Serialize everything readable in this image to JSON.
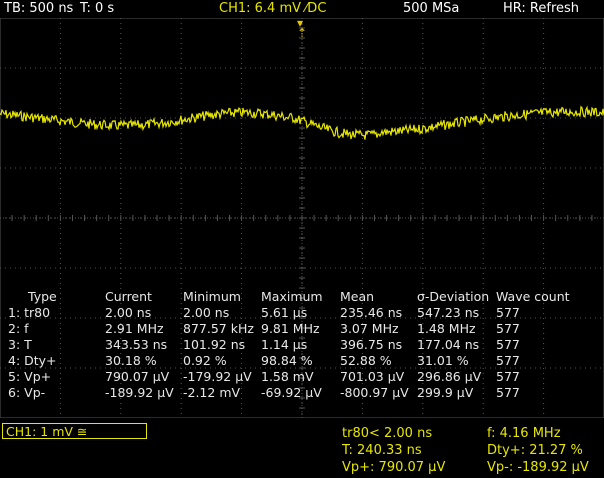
{
  "header": {
    "timebase": "TB: 500 ns",
    "trigger_time": "T: 0 s",
    "channel": "CH1: 6.4 mV ⁄DC",
    "sample_rate": "500 MSa",
    "mode": "HR: Refresh"
  },
  "table": {
    "headers": [
      "Type",
      "Current",
      "Minimum",
      "Maximum",
      "Mean",
      "σ-Deviation",
      "Wave count"
    ],
    "rows": [
      [
        "1: tr80",
        "2.00 ns",
        "2.00 ns",
        "5.61 µs",
        "235.46 ns",
        "547.23 ns",
        "577"
      ],
      [
        "2: f",
        "2.91 MHz",
        "877.57 kHz",
        "9.81 MHz",
        "3.07 MHz",
        "1.48 MHz",
        "577"
      ],
      [
        "3: T",
        "343.53 ns",
        "101.92 ns",
        "1.14 µs",
        "396.75 ns",
        "177.04 ns",
        "577"
      ],
      [
        "4: Dty+",
        "30.18 %",
        "0.92 %",
        "98.84 %",
        "52.88 %",
        "31.01 %",
        "577"
      ],
      [
        "5: Vp+",
        "790.07 µV",
        "-179.92 µV",
        "1.58 mV",
        "701.03 µV",
        "296.86 µV",
        "577"
      ],
      [
        "6: Vp-",
        "-189.92 µV",
        "-2.12 mV",
        "-69.92 µV",
        "-800.97 µV",
        "299.9 µV",
        "577"
      ]
    ]
  },
  "footer": {
    "ch1_label": "CH1: 1 mV ≅",
    "tr80": "tr80< 2.00 ns",
    "T": "T: 240.33 ns",
    "vp_plus": "Vp+: 790.07 µV",
    "f": "f: 4.16 MHz",
    "dty": "Dty+: 21.27 %",
    "vp_minus": "Vp-: -189.92 µV"
  },
  "colors": {
    "trace": "#e6e600",
    "grid": "#555555",
    "text": "#e8e8e8"
  }
}
